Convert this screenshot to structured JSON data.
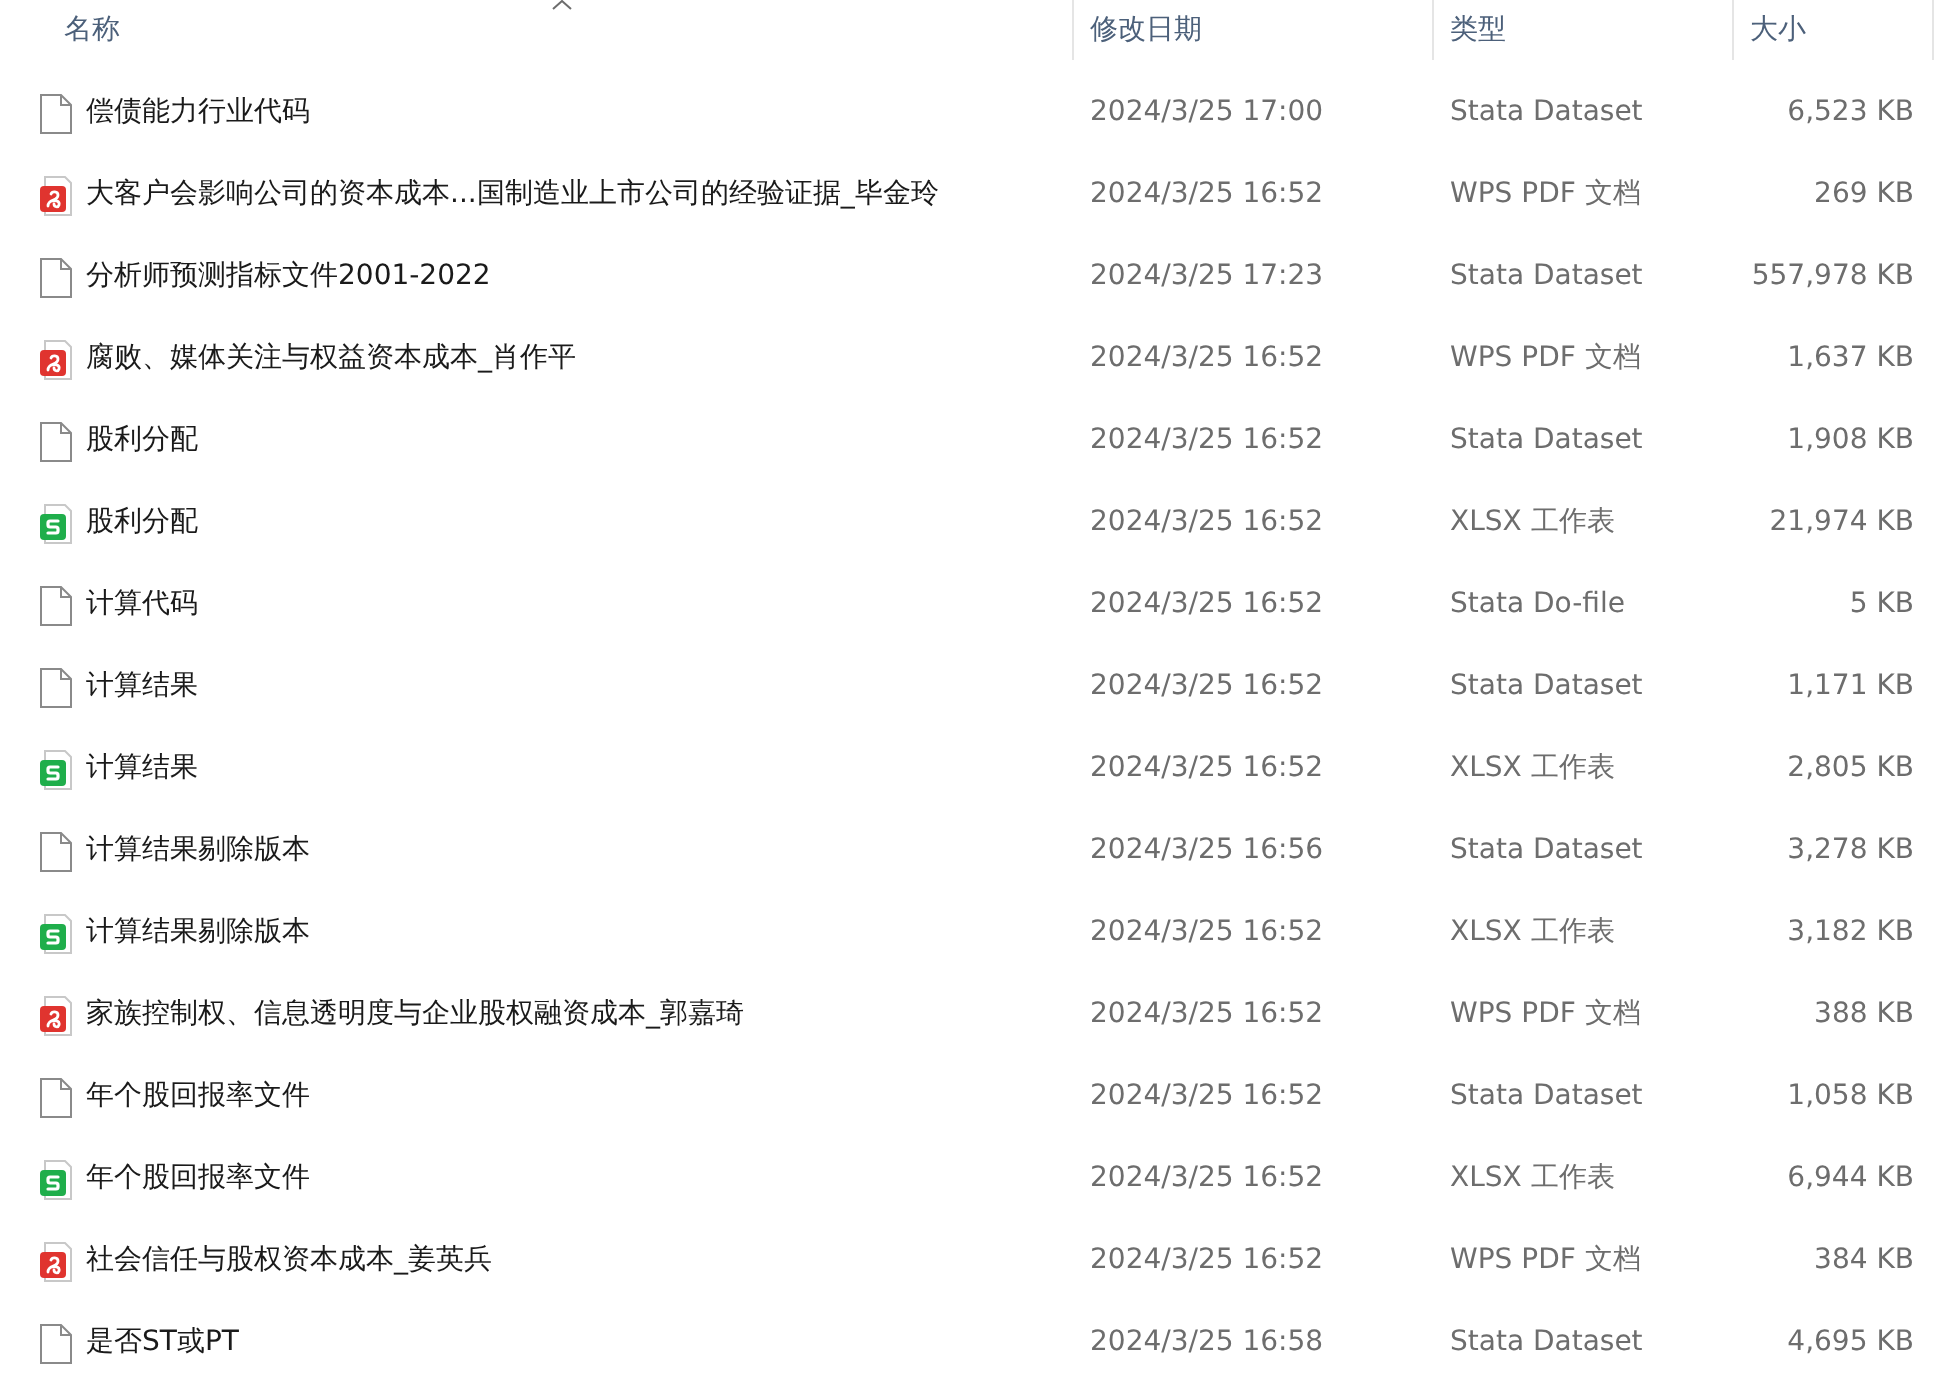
{
  "columns": [
    {
      "label": "名称",
      "sorted": true
    },
    {
      "label": "修改日期",
      "sorted": false
    },
    {
      "label": "类型",
      "sorted": false
    },
    {
      "label": "大小",
      "sorted": false
    }
  ],
  "rows": [
    {
      "kind": "file",
      "name": "偿债能力行业代码",
      "modified": "2024/3/25 17:00",
      "type": "Stata Dataset",
      "size": "6,523 KB"
    },
    {
      "kind": "pdf",
      "name": "大客户会影响公司的资本成本...国制造业上市公司的经验证据_毕金玲",
      "modified": "2024/3/25 16:52",
      "type": "WPS PDF 文档",
      "size": "269 KB"
    },
    {
      "kind": "file",
      "name": "分析师预测指标文件2001-2022",
      "modified": "2024/3/25 17:23",
      "type": "Stata Dataset",
      "size": "557,978 KB"
    },
    {
      "kind": "pdf",
      "name": "腐败、媒体关注与权益资本成本_肖作平",
      "modified": "2024/3/25 16:52",
      "type": "WPS PDF 文档",
      "size": "1,637 KB"
    },
    {
      "kind": "file",
      "name": "股利分配",
      "modified": "2024/3/25 16:52",
      "type": "Stata Dataset",
      "size": "1,908 KB"
    },
    {
      "kind": "sheet",
      "name": "股利分配",
      "modified": "2024/3/25 16:52",
      "type": "XLSX 工作表",
      "size": "21,974 KB"
    },
    {
      "kind": "file",
      "name": "计算代码",
      "modified": "2024/3/25 16:52",
      "type": "Stata Do-file",
      "size": "5 KB"
    },
    {
      "kind": "file",
      "name": "计算结果",
      "modified": "2024/3/25 16:52",
      "type": "Stata Dataset",
      "size": "1,171 KB"
    },
    {
      "kind": "sheet",
      "name": "计算结果",
      "modified": "2024/3/25 16:52",
      "type": "XLSX 工作表",
      "size": "2,805 KB"
    },
    {
      "kind": "file",
      "name": "计算结果剔除版本",
      "modified": "2024/3/25 16:56",
      "type": "Stata Dataset",
      "size": "3,278 KB"
    },
    {
      "kind": "sheet",
      "name": "计算结果剔除版本",
      "modified": "2024/3/25 16:52",
      "type": "XLSX 工作表",
      "size": "3,182 KB"
    },
    {
      "kind": "pdf",
      "name": "家族控制权、信息透明度与企业股权融资成本_郭嘉琦",
      "modified": "2024/3/25 16:52",
      "type": "WPS PDF 文档",
      "size": "388 KB"
    },
    {
      "kind": "file",
      "name": "年个股回报率文件",
      "modified": "2024/3/25 16:52",
      "type": "Stata Dataset",
      "size": "1,058 KB"
    },
    {
      "kind": "sheet",
      "name": "年个股回报率文件",
      "modified": "2024/3/25 16:52",
      "type": "XLSX 工作表",
      "size": "6,944 KB"
    },
    {
      "kind": "pdf",
      "name": "社会信任与股权资本成本_姜英兵",
      "modified": "2024/3/25 16:52",
      "type": "WPS PDF 文档",
      "size": "384 KB"
    },
    {
      "kind": "file",
      "name": "是否ST或PT",
      "modified": "2024/3/25 16:58",
      "type": "Stata Dataset",
      "size": "4,695 KB"
    }
  ]
}
